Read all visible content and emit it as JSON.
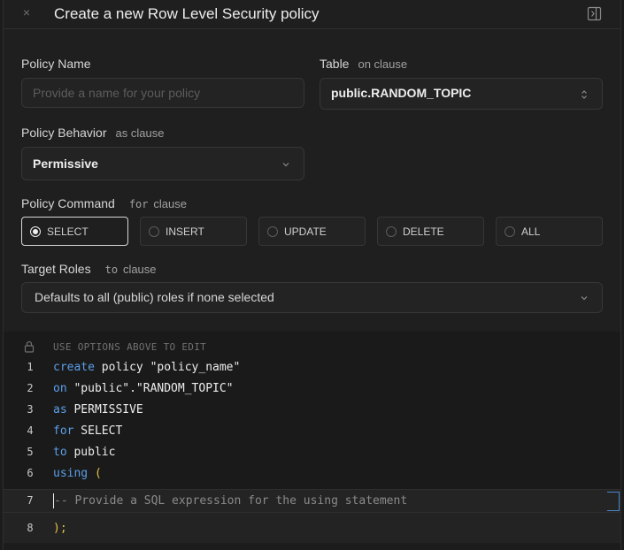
{
  "header": {
    "title": "Create a new Row Level Security policy",
    "close_glyph": "×"
  },
  "form": {
    "policy_name": {
      "label": "Policy Name",
      "placeholder": "Provide a name for your policy",
      "value": ""
    },
    "table": {
      "label": "Table",
      "sublabel": "on clause",
      "value": "public.RANDOM_TOPIC"
    },
    "behavior": {
      "label": "Policy Behavior",
      "sublabel": "as clause",
      "value": "Permissive"
    },
    "command": {
      "label": "Policy Command",
      "sublabel_mono": "for",
      "sublabel": "clause",
      "options": [
        "SELECT",
        "INSERT",
        "UPDATE",
        "DELETE",
        "ALL"
      ],
      "selected": "SELECT"
    },
    "roles": {
      "label": "Target Roles",
      "sublabel_mono": "to",
      "sublabel": "clause",
      "value": "Defaults to all (public) roles if none selected"
    }
  },
  "editor": {
    "hint": "USE OPTIONS ABOVE TO EDIT",
    "lines": [
      {
        "num": "1",
        "kw": "create",
        "rest": " policy \"policy_name\""
      },
      {
        "num": "2",
        "kw": "on",
        "rest": " \"public\".\"RANDOM_TOPIC\""
      },
      {
        "num": "3",
        "kw": "as",
        "rest": " PERMISSIVE"
      },
      {
        "num": "4",
        "kw": "for",
        "rest": " SELECT"
      },
      {
        "num": "5",
        "kw": "to",
        "rest": " public"
      },
      {
        "num": "6",
        "kw": "using",
        "rest": " ("
      }
    ],
    "active_line": {
      "num": "7",
      "text": "-- Provide a SQL expression for the using statement"
    },
    "last_line": {
      "num": "8",
      "text": ");"
    }
  },
  "colors": {
    "keyword": "#5b9fe8",
    "paren": "#e6c04a",
    "background": "#1f1f1f"
  }
}
